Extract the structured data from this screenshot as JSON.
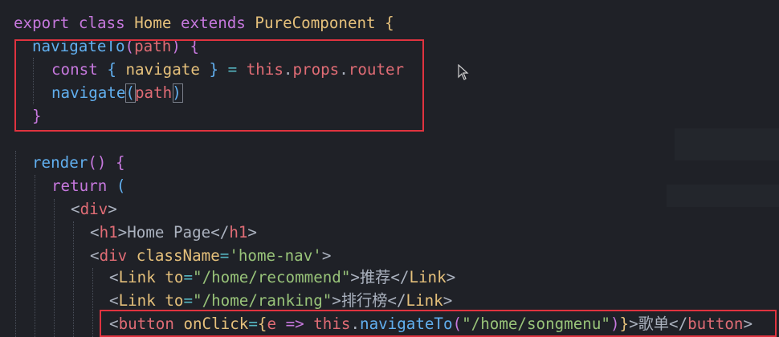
{
  "code": {
    "line1": {
      "kw1": "export",
      "kw2": "class",
      "cls": "Home",
      "kw3": "extends",
      "base": "PureComponent",
      "brace": "{"
    },
    "line2": {
      "fn": "navigateTo",
      "open": "(",
      "param": "path",
      "close": ")",
      "brace": "{"
    },
    "line3": {
      "kw": "const",
      "ob": "{",
      "var": "navigate",
      "cb": "}",
      "eq": "=",
      "this": "this",
      "dot1": ".",
      "props": "props",
      "dot2": ".",
      "router": "router"
    },
    "line4": {
      "fn": "navigate",
      "open": "(",
      "arg": "path",
      "close": ")"
    },
    "line5": {
      "brace": "}"
    },
    "line6": {
      "fn": "render",
      "parens": "()",
      "brace": "{"
    },
    "line7": {
      "kw": "return",
      "paren": "("
    },
    "line8": {
      "lt": "<",
      "tag": "div",
      "gt": ">"
    },
    "line9": {
      "lt": "<",
      "tag": "h1",
      "gt": ">",
      "text": "Home Page",
      "lt2": "</",
      "tag2": "h1",
      "gt2": ">"
    },
    "line10": {
      "lt": "<",
      "tag": "div",
      "attr": "className",
      "eq": "=",
      "val": "'home-nav'",
      "gt": ">"
    },
    "line11": {
      "lt": "<",
      "tag": "Link",
      "attr": "to",
      "eq": "=",
      "val": "\"/home/recommend\"",
      "gt": ">",
      "text": "推荐",
      "lt2": "</",
      "tag2": "Link",
      "gt2": ">"
    },
    "line12": {
      "lt": "<",
      "tag": "Link",
      "attr": "to",
      "eq": "=",
      "val": "\"/home/ranking\"",
      "gt": ">",
      "text": "排行榜",
      "lt2": "</",
      "tag2": "Link",
      "gt2": ">"
    },
    "line13": {
      "lt": "<",
      "tag": "button",
      "attr": "onClick",
      "eq": "=",
      "ob": "{",
      "param": "e",
      "arrow": "=>",
      "this": "this",
      "dot": ".",
      "fn": "navigateTo",
      "op": "(",
      "val": "\"/home/songmenu\"",
      "cp": ")",
      "cb": "}",
      "gt": ">",
      "text": "歌单",
      "lt2": "</",
      "tag2": "button",
      "gt2": ">"
    }
  },
  "colors": {
    "background": "#1f2127",
    "keyword": "#c678dd",
    "function": "#61afef",
    "tag": "#e06c75",
    "string": "#98c379",
    "class": "#e5c07b",
    "operator": "#56b6c2",
    "highlight_box": "#e0333f"
  },
  "icons": {
    "cursor": "mouse-pointer-icon"
  }
}
